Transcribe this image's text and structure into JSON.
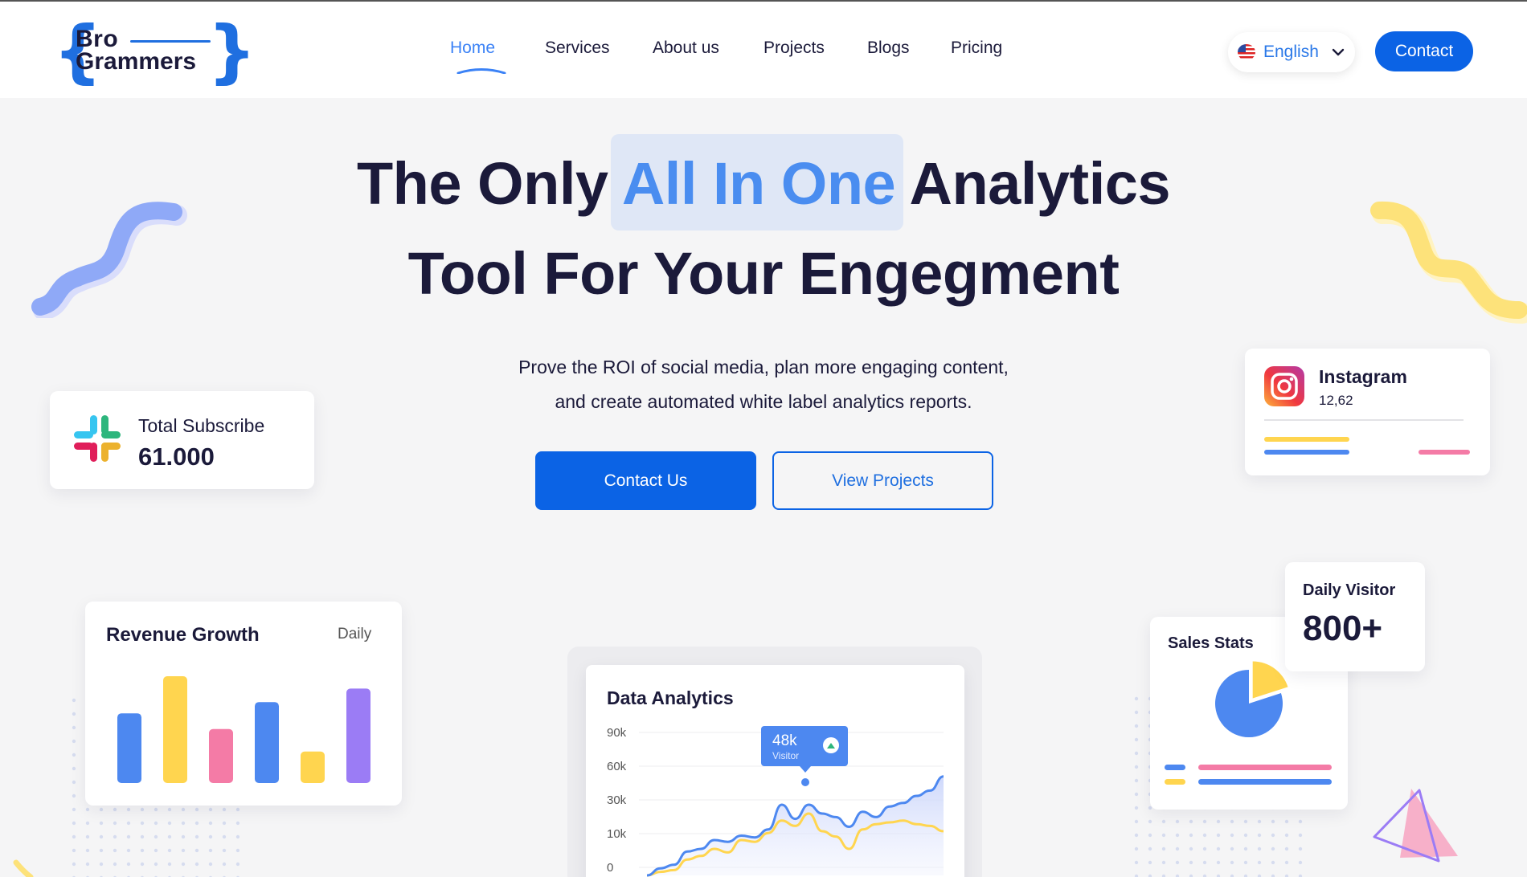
{
  "brand": {
    "name_line1": "Bro",
    "name_line2": "Grammers",
    "accent": "#1f6fe0"
  },
  "nav": {
    "items": [
      {
        "label": "Home",
        "active": true
      },
      {
        "label": "Services"
      },
      {
        "label": "About us"
      },
      {
        "label": "Projects"
      },
      {
        "label": "Blogs"
      },
      {
        "label": "Pricing"
      }
    ]
  },
  "language": {
    "label": "English",
    "flag_icon": "us-flag-icon"
  },
  "header_cta": {
    "label": "Contact"
  },
  "hero": {
    "title_pre": "The Only ",
    "title_accent": "All In One",
    "title_post": " Analytics",
    "title_line2": "Tool For Your Engegment",
    "subtitle_line1": "Prove the ROI of social media, plan more engaging content,",
    "subtitle_line2": "and create automated white label analytics reports.",
    "primary_cta": "Contact Us",
    "secondary_cta": "View Projects"
  },
  "subscribe_card": {
    "label": "Total Subscribe",
    "value": "61.000",
    "icon": "slack-icon"
  },
  "instagram_card": {
    "name": "Instagram",
    "value": "12,62",
    "icon": "instagram-icon"
  },
  "revenue_card": {
    "title": "Revenue Growth",
    "period": "Daily",
    "chart_data": {
      "type": "bar",
      "values": [
        0.62,
        0.95,
        0.48,
        0.72,
        0.28,
        0.84
      ],
      "colors": [
        "#4d88f0",
        "#ffd54f",
        "#f47ba6",
        "#4d88f0",
        "#ffd54f",
        "#9b7cf5"
      ]
    }
  },
  "analytics_card": {
    "title": "Data Analytics",
    "tooltip_value": "48k",
    "tooltip_label": "Visitor",
    "chart_data": {
      "type": "line",
      "y_ticks": [
        "90k",
        "60k",
        "30k",
        "10k",
        "0"
      ],
      "series": [
        {
          "color": "#4d88f0",
          "values": [
            0,
            8,
            12,
            27,
            30,
            40,
            38,
            45,
            43,
            52,
            80,
            64,
            80,
            70,
            66,
            55,
            72,
            66,
            78,
            82,
            90,
            96,
            112
          ]
        },
        {
          "color": "#ffd54f",
          "values": [
            0,
            4,
            6,
            18,
            22,
            30,
            26,
            40,
            38,
            48,
            62,
            56,
            70,
            50,
            44,
            30,
            52,
            58,
            60,
            62,
            58,
            56,
            50
          ]
        }
      ]
    }
  },
  "sales_card": {
    "title": "Sales Stats",
    "chart_data": {
      "type": "pie",
      "values": [
        0.8,
        0.2
      ],
      "colors": [
        "#4d88f0",
        "#ffd54f"
      ]
    }
  },
  "visitor_card": {
    "label": "Daily Visitor",
    "value": "800+"
  }
}
